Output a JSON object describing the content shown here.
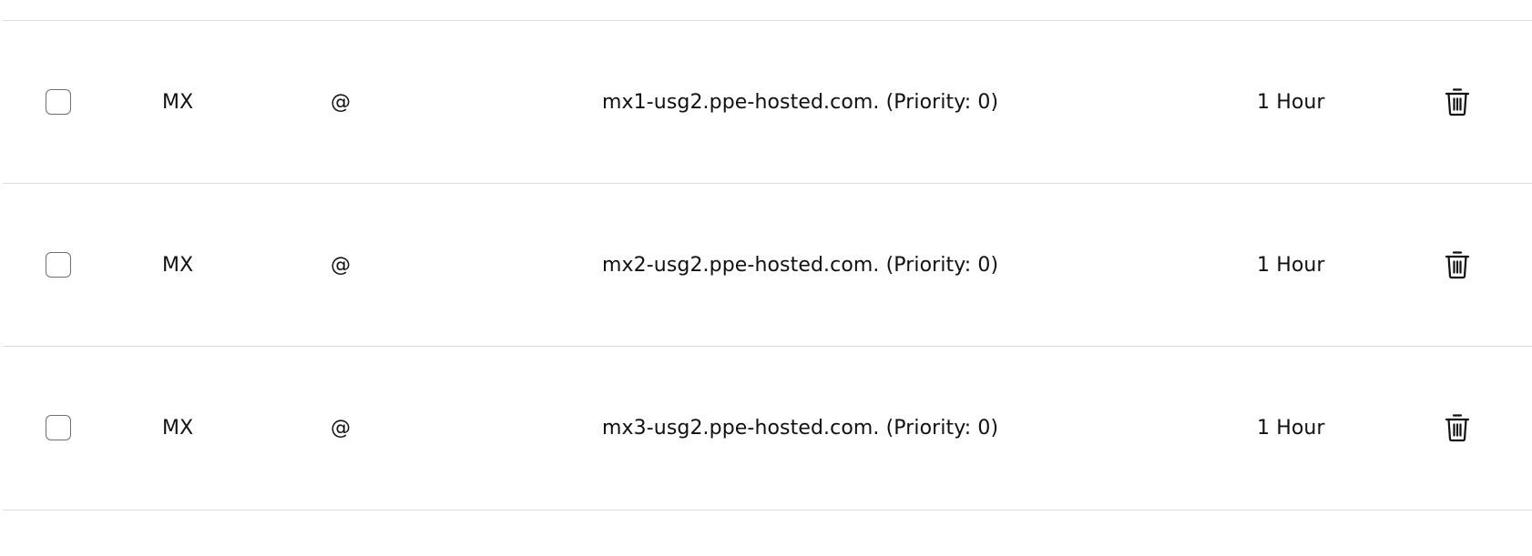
{
  "records": [
    {
      "type": "MX",
      "name": "@",
      "value": "mx1-usg2.ppe-hosted.com. (Priority: 0)",
      "ttl": "1 Hour"
    },
    {
      "type": "MX",
      "name": "@",
      "value": "mx2-usg2.ppe-hosted.com. (Priority: 0)",
      "ttl": "1 Hour"
    },
    {
      "type": "MX",
      "name": "@",
      "value": "mx3-usg2.ppe-hosted.com. (Priority: 0)",
      "ttl": "1 Hour"
    }
  ],
  "icons": {
    "select": "checkbox-icon",
    "delete": "trash-icon"
  }
}
